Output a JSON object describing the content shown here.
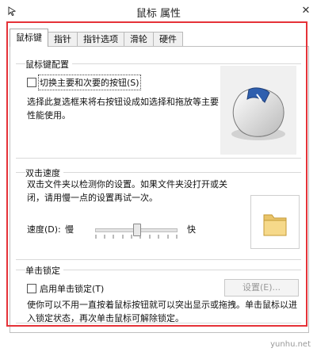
{
  "window": {
    "title": "鼠标 属性"
  },
  "tabs": [
    {
      "label": "鼠标键"
    },
    {
      "label": "指针"
    },
    {
      "label": "指针选项"
    },
    {
      "label": "滑轮"
    },
    {
      "label": "硬件"
    }
  ],
  "button_config": {
    "group_title": "鼠标键配置",
    "swap_label": "切换主要和次要的按钮(S)",
    "swap_checked": false,
    "description_line1": "选择此复选框来将右按钮设成如选择和拖放等主要",
    "description_line2": "性能使用。"
  },
  "double_click": {
    "group_title": "双击速度",
    "description_line1": "双击文件夹以检测你的设置。如果文件夹没打开或关",
    "description_line2": "闭，请用慢一点的设置再试一次。",
    "speed_label": "速度(D):",
    "slow_label": "慢",
    "fast_label": "快",
    "speed_value": 0.5
  },
  "click_lock": {
    "group_title": "单击锁定",
    "enable_label": "启用单击锁定(T)",
    "enabled": false,
    "settings_button": "设置(E)...",
    "description_line1": "使你可以不用一直按着鼠标按钮就可以突出显示或拖拽。单击鼠标以进",
    "description_line2": "入锁定状态，再次单击鼠标可解除锁定。"
  },
  "watermark": "yunhu.net",
  "colors": {
    "highlight_frame": "#e53238"
  }
}
